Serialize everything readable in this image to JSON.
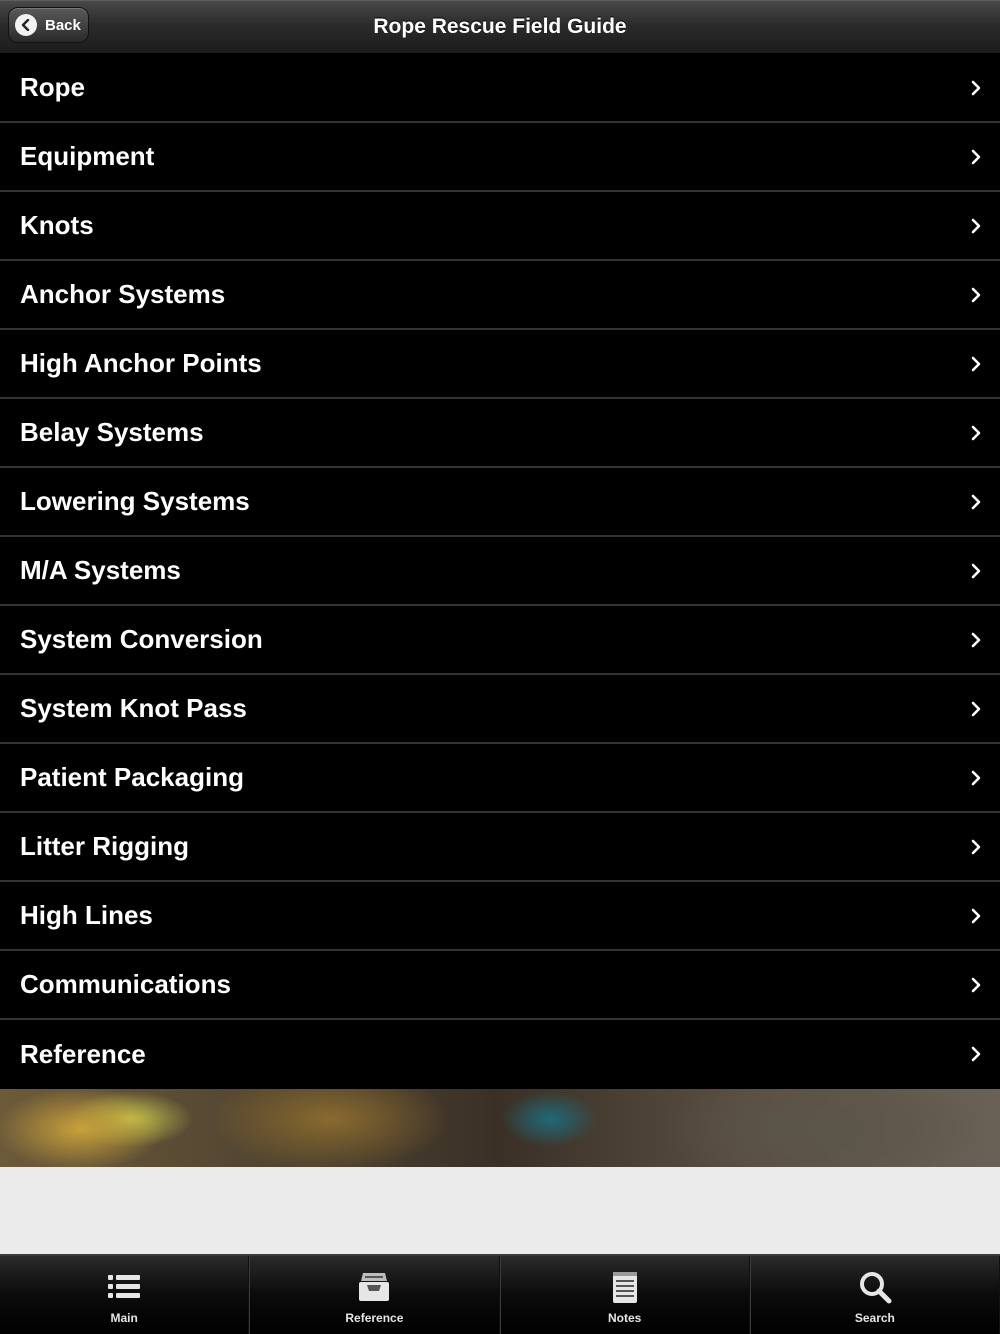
{
  "navbar": {
    "back_label": "Back",
    "title": "Rope Rescue Field Guide"
  },
  "menu": {
    "items": [
      {
        "label": "Rope"
      },
      {
        "label": "Equipment"
      },
      {
        "label": "Knots"
      },
      {
        "label": "Anchor Systems"
      },
      {
        "label": "High Anchor Points"
      },
      {
        "label": "Belay Systems"
      },
      {
        "label": "Lowering Systems"
      },
      {
        "label": "M/A Systems"
      },
      {
        "label": "System Conversion"
      },
      {
        "label": "System Knot Pass"
      },
      {
        "label": "Patient Packaging"
      },
      {
        "label": "Litter Rigging"
      },
      {
        "label": "High Lines"
      },
      {
        "label": "Communications"
      },
      {
        "label": "Reference"
      }
    ]
  },
  "tabbar": {
    "tabs": [
      {
        "label": "Main",
        "icon": "list-icon"
      },
      {
        "label": "Reference",
        "icon": "inbox-tray-icon"
      },
      {
        "label": "Notes",
        "icon": "notepad-icon"
      },
      {
        "label": "Search",
        "icon": "magnifier-icon"
      }
    ]
  },
  "colors": {
    "background": "#000000",
    "row_divider": "#333333",
    "text": "#ffffff",
    "gray_area": "#ebebeb"
  }
}
